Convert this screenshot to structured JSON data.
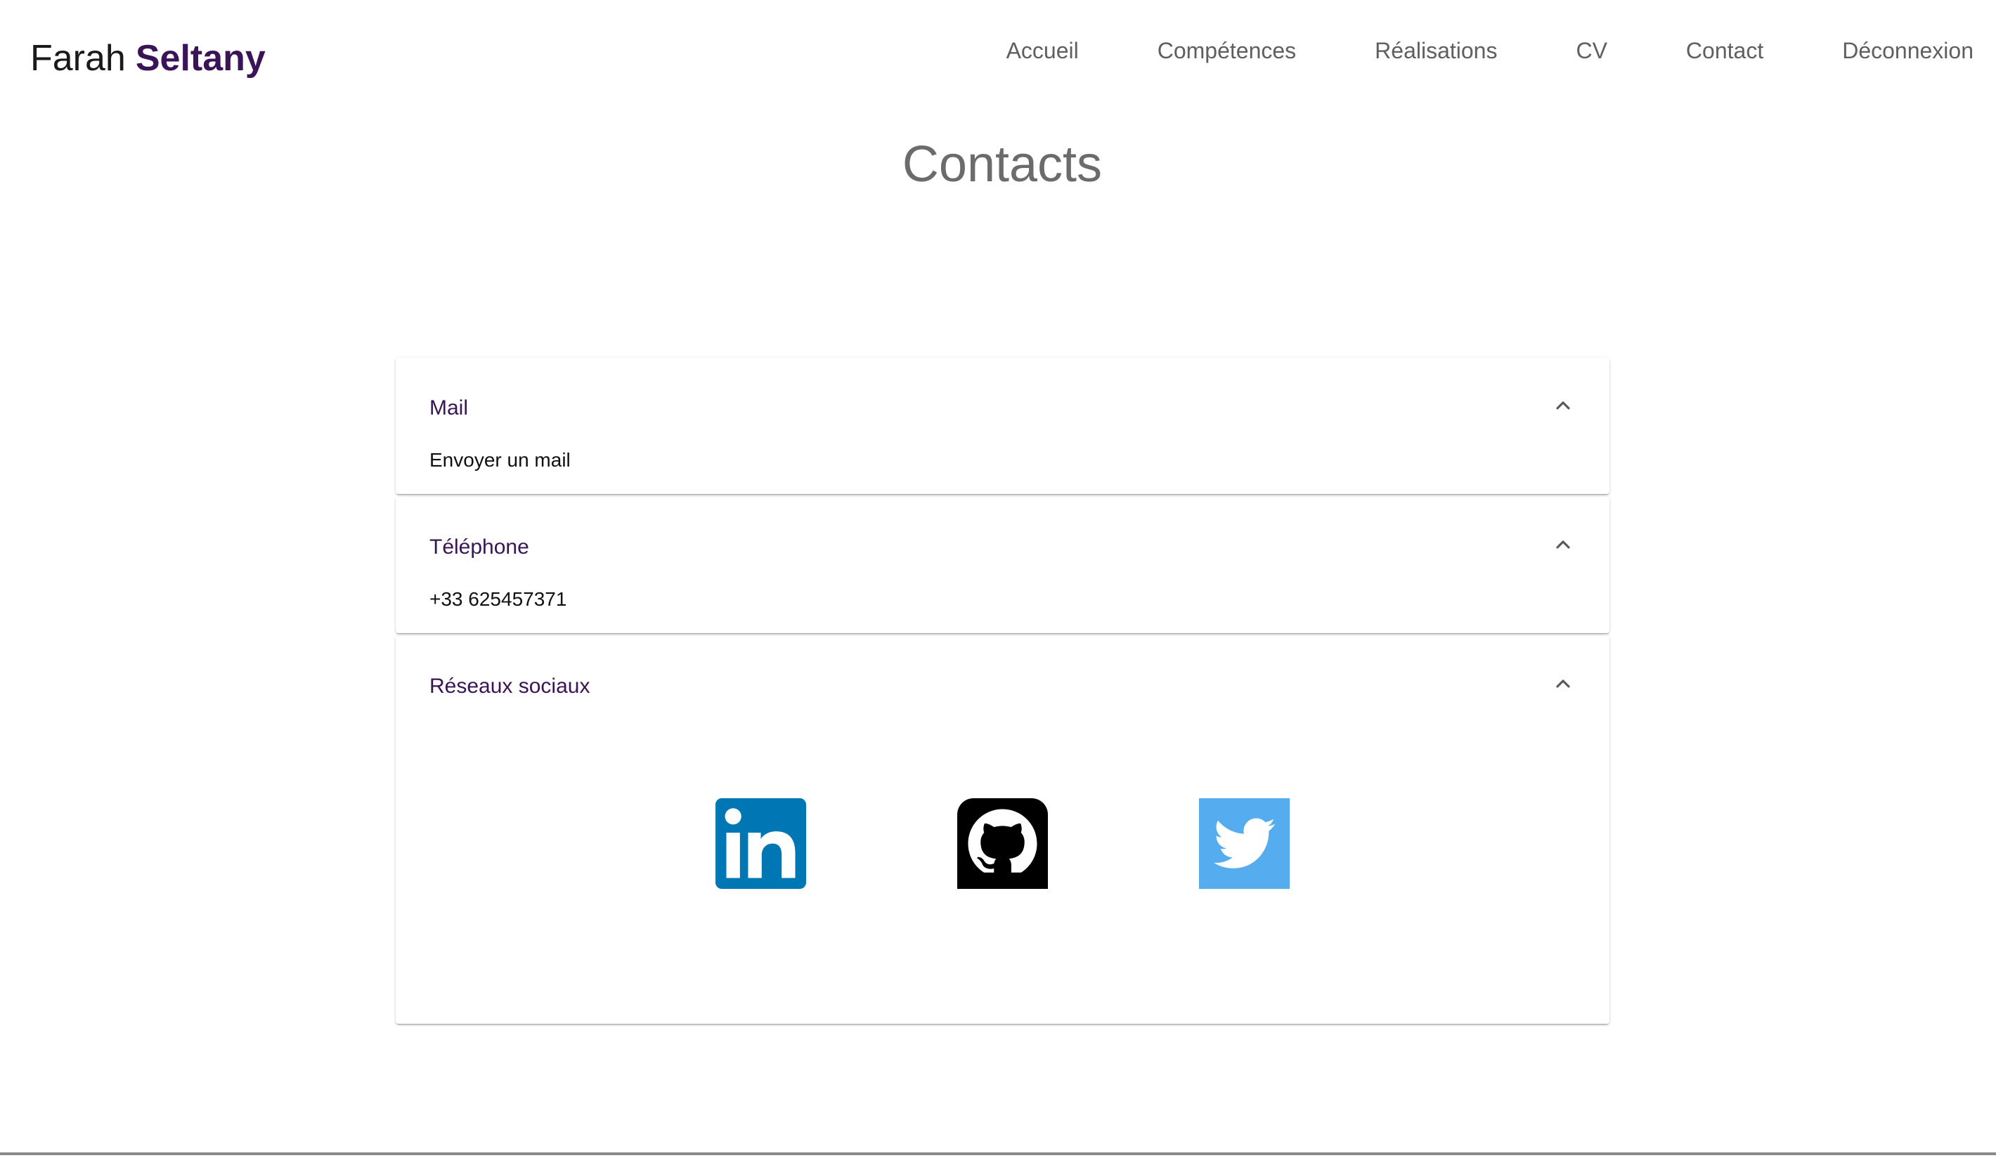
{
  "brand": {
    "first_name": "Farah",
    "last_name": "Seltany"
  },
  "nav": {
    "items": [
      "Accueil",
      "Compétences",
      "Réalisations",
      "CV",
      "Contact",
      "Déconnexion"
    ]
  },
  "page": {
    "title": "Contacts"
  },
  "accordion": {
    "panels": [
      {
        "title": "Mail",
        "content": "Envoyer un mail",
        "icon": "chevron-up-icon"
      },
      {
        "title": "Téléphone",
        "content": "+33 625457371",
        "icon": "chevron-up-icon"
      },
      {
        "title": "Réseaux sociaux",
        "icon": "chevron-up-icon"
      }
    ]
  },
  "social": {
    "links": [
      {
        "icon": "linkedin-icon",
        "color": "#0077B5"
      },
      {
        "icon": "github-icon",
        "color": "#000000"
      },
      {
        "icon": "twitter-icon",
        "color": "#55ACEE"
      }
    ]
  },
  "colors": {
    "accent": "#3a1457",
    "nav_text": "#5f5f5f",
    "title_text": "#6b6b6b"
  }
}
